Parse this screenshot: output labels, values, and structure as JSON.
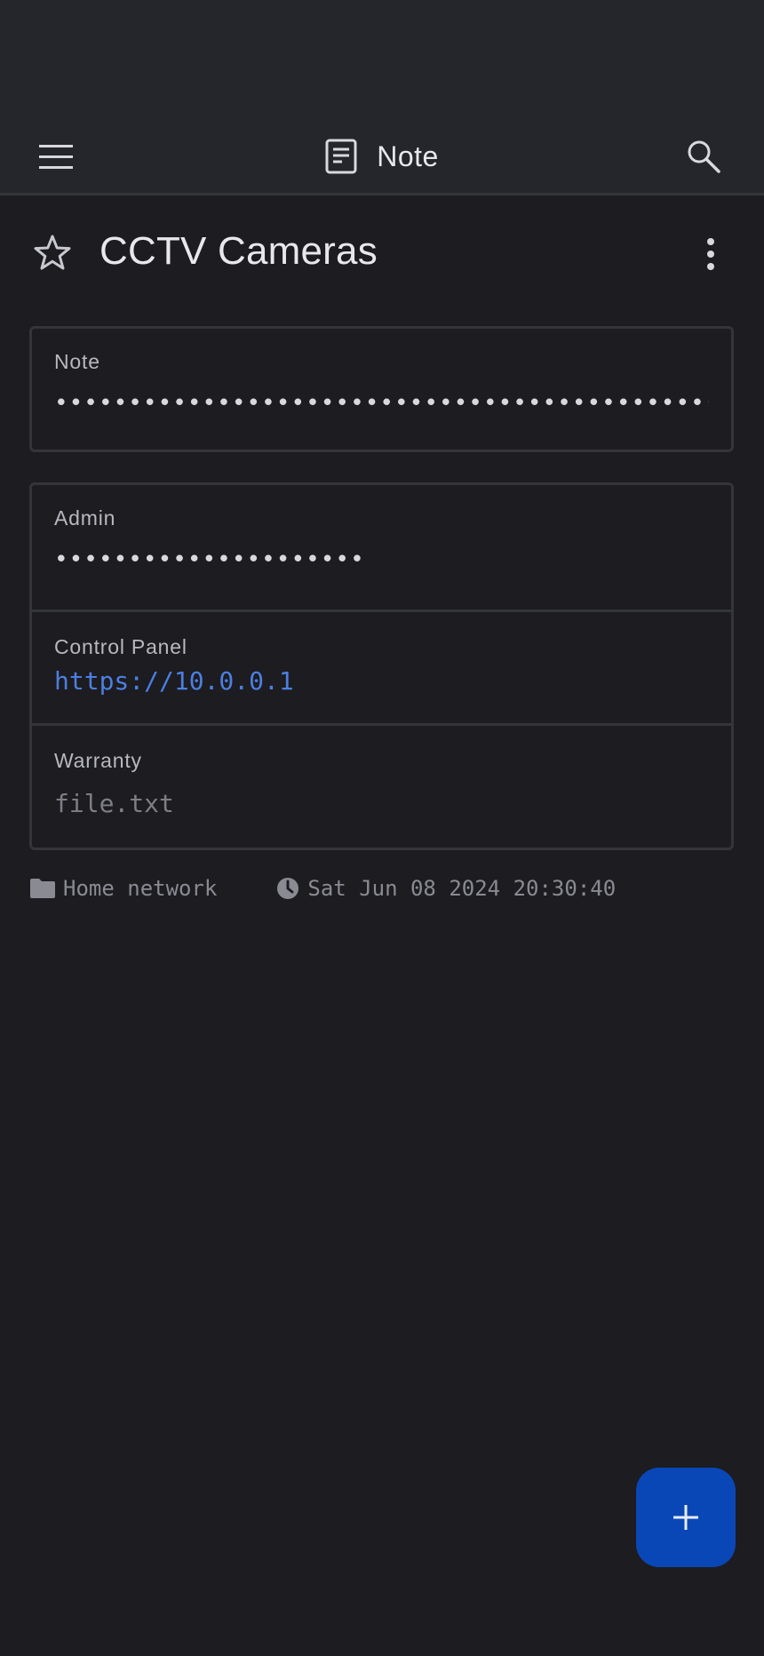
{
  "app_bar": {
    "title": "Note",
    "title_icon": "note-icon",
    "menu_icon": "menu-icon",
    "search_icon": "search-icon"
  },
  "item": {
    "title": "CCTV Cameras",
    "favorite_icon": "star-outline-icon",
    "more_icon": "more-vertical-icon"
  },
  "note_field": {
    "label": "Note",
    "value": "••••••••••••••••••••••••••••••••••••••••••••••••"
  },
  "fields": [
    {
      "label": "Admin",
      "value": "•••••••••••••••••••••",
      "kind": "hidden"
    },
    {
      "label": "Control Panel",
      "value": "https://10.0.0.1",
      "kind": "link"
    },
    {
      "label": "Warranty",
      "value": "file.txt",
      "kind": "file"
    }
  ],
  "meta": {
    "folder_icon": "folder-icon",
    "folder": "Home network",
    "clock_icon": "clock-icon",
    "timestamp": "Sat Jun 08 2024 20:30:40"
  },
  "fab": {
    "icon": "plus-icon"
  },
  "colors": {
    "background": "#1c1c21",
    "app_bar": "#25262c",
    "border": "#34353b",
    "link": "#4c7fe0",
    "fab": "#0a47b6"
  }
}
